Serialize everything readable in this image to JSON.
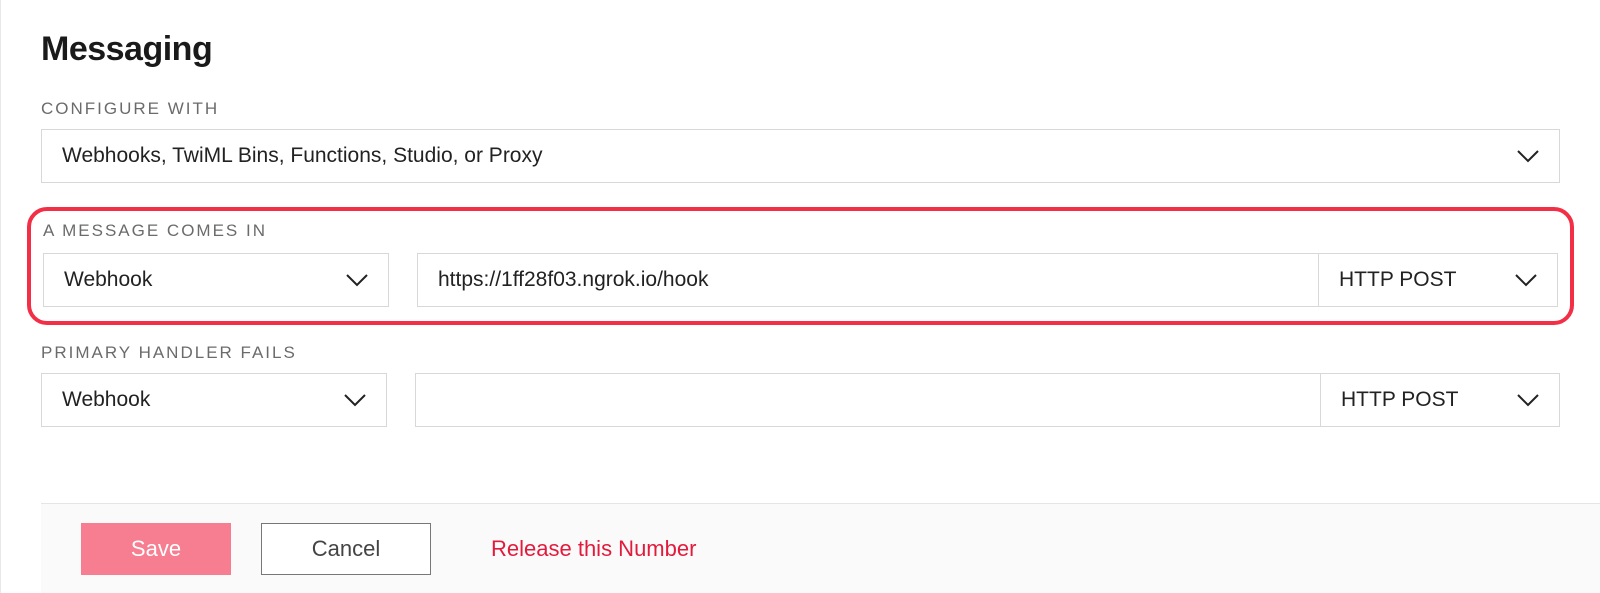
{
  "section_title": "Messaging",
  "configure_with": {
    "label": "CONFIGURE WITH",
    "value": "Webhooks, TwiML Bins, Functions, Studio, or Proxy"
  },
  "message_comes_in": {
    "label": "A MESSAGE COMES IN",
    "handler_type": "Webhook",
    "url_value": "https://1ff28f03.ngrok.io/hook",
    "http_method": "HTTP POST"
  },
  "primary_handler_fails": {
    "label": "PRIMARY HANDLER FAILS",
    "handler_type": "Webhook",
    "url_value": "",
    "http_method": "HTTP POST"
  },
  "footer": {
    "save": "Save",
    "cancel": "Cancel",
    "release": "Release this Number"
  }
}
